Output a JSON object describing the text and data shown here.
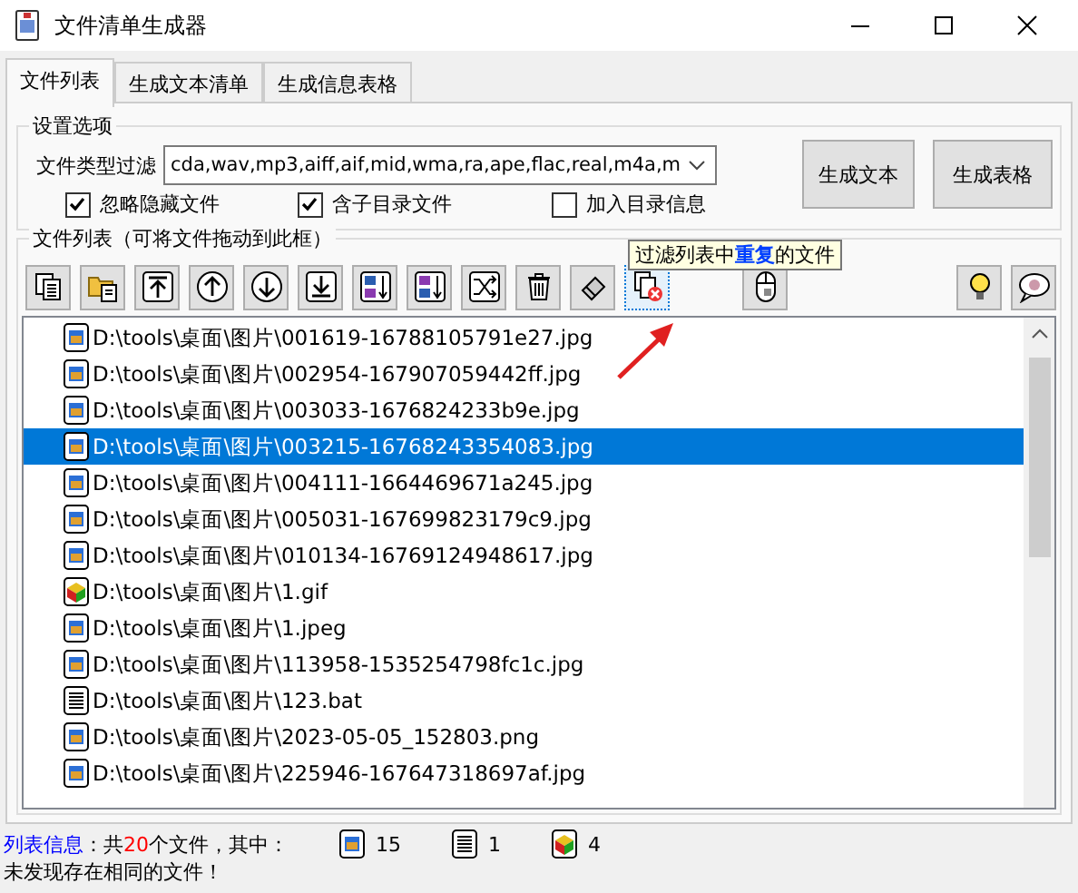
{
  "window": {
    "title": "文件清单生成器"
  },
  "tabs": [
    {
      "label": "文件列表",
      "selected": true
    },
    {
      "label": "生成文本清单",
      "selected": false
    },
    {
      "label": "生成信息表格",
      "selected": false
    }
  ],
  "settings": {
    "title": "设置选项",
    "filter_label": "文件类型过滤",
    "filter_value": "cda,wav,mp3,aiff,aif,mid,wma,ra,ape,flac,real,m4a,m",
    "options": [
      {
        "label": "忽略隐藏文件",
        "checked": true
      },
      {
        "label": "含子目录文件",
        "checked": true
      },
      {
        "label": "加入目录信息",
        "checked": false
      }
    ],
    "buttons": [
      "生成文本",
      "生成表格"
    ]
  },
  "file_list": {
    "title": "文件列表（可将文件拖动到此框）",
    "toolbar": [
      {
        "kind": "copy",
        "selected": false
      },
      {
        "kind": "folder",
        "selected": false
      },
      {
        "kind": "top",
        "selected": false
      },
      {
        "kind": "up",
        "selected": false
      },
      {
        "kind": "down",
        "selected": false
      },
      {
        "kind": "bottom",
        "selected": false
      },
      {
        "kind": "sort-az",
        "selected": false
      },
      {
        "kind": "sort-za",
        "selected": false
      },
      {
        "kind": "shuffle",
        "selected": false
      },
      {
        "kind": "trash",
        "selected": false
      },
      {
        "kind": "eraser",
        "selected": false
      },
      {
        "kind": "dedupe",
        "selected": true
      },
      {
        "kind": "mouse",
        "selected": false
      }
    ],
    "toolbar_right": [
      {
        "kind": "bulb"
      },
      {
        "kind": "chat"
      }
    ],
    "tooltip": "过滤列表中**重复**的文件",
    "rows": [
      {
        "path": "D:\\tools\\桌面\\图片\\001619-16788105791e27.jpg",
        "kind": "image",
        "selected": false
      },
      {
        "path": "D:\\tools\\桌面\\图片\\002954-167907059442ff.jpg",
        "kind": "image",
        "selected": false
      },
      {
        "path": "D:\\tools\\桌面\\图片\\003033-1676824233b9e.jpg",
        "kind": "image",
        "selected": false
      },
      {
        "path": "D:\\tools\\桌面\\图片\\003215-16768243354083.jpg",
        "kind": "image",
        "selected": true
      },
      {
        "path": "D:\\tools\\桌面\\图片\\004111-1664469671a245.jpg",
        "kind": "image",
        "selected": false
      },
      {
        "path": "D:\\tools\\桌面\\图片\\005031-167699823179c9.jpg",
        "kind": "image",
        "selected": false
      },
      {
        "path": "D:\\tools\\桌面\\图片\\010134-16769124948617.jpg",
        "kind": "image",
        "selected": false
      },
      {
        "path": "D:\\tools\\桌面\\图片\\1.gif",
        "kind": "cube",
        "selected": false
      },
      {
        "path": "D:\\tools\\桌面\\图片\\1.jpeg",
        "kind": "image",
        "selected": false
      },
      {
        "path": "D:\\tools\\桌面\\图片\\113958-1535254798fc1c.jpg",
        "kind": "image",
        "selected": false
      },
      {
        "path": "D:\\tools\\桌面\\图片\\123.bat",
        "kind": "text",
        "selected": false
      },
      {
        "path": "D:\\tools\\桌面\\图片\\2023-05-05_152803.png",
        "kind": "image",
        "selected": false
      },
      {
        "path": "D:\\tools\\桌面\\图片\\225946-167647318697af.jpg",
        "kind": "image",
        "selected": false
      }
    ]
  },
  "status": {
    "label": "列表信息",
    "prefix": "：共",
    "count": "20",
    "suffix": "个文件，其中：",
    "counts": [
      {
        "kind": "image",
        "count": "15"
      },
      {
        "kind": "text",
        "count": "1"
      },
      {
        "kind": "cube",
        "count": "4"
      }
    ],
    "message": "未发现存在相同的文件！"
  }
}
